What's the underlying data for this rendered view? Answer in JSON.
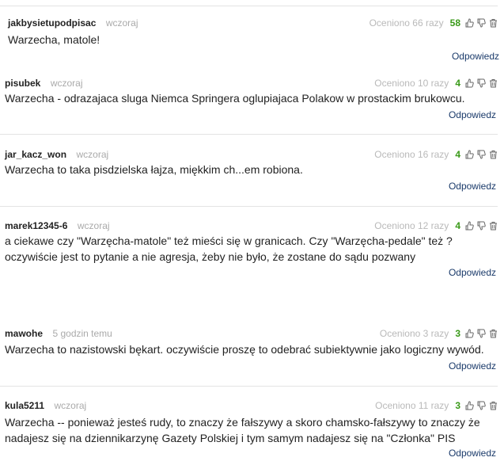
{
  "comments": [
    {
      "author": "jakbysietupodpisac",
      "time": "wczoraj",
      "rated_label": "Oceniono 66 razy",
      "score": "58",
      "text": "Warzecha, matole!",
      "reply_label": "Odpowiedz"
    },
    {
      "author": "pisubek",
      "time": "wczoraj",
      "rated_label": "Oceniono 10 razy",
      "score": "4",
      "text": "Warzecha - odrazajaca sluga Niemca Springera oglupiajaca Polakow w prostackim brukowcu.",
      "reply_label": "Odpowiedz"
    },
    {
      "author": "jar_kacz_won",
      "time": "wczoraj",
      "rated_label": "Oceniono 16 razy",
      "score": "4",
      "text": "Warzecha to taka pisdzielska łajza, miękkim ch...em robiona.",
      "reply_label": "Odpowiedz"
    },
    {
      "author": "marek12345-6",
      "time": "wczoraj",
      "rated_label": "Oceniono 12 razy",
      "score": "4",
      "text": "a ciekawe czy \"Warzęcha-matole\" też mieści się w granicach. Czy \"Warzęcha-pedale\" też ?\noczywiście jest to pytanie a nie agresja, żeby nie było, że zostane do sądu pozwany",
      "reply_label": "Odpowiedz"
    },
    {
      "author": "mawohe",
      "time": "5 godzin temu",
      "rated_label": "Oceniono 3 razy",
      "score": "3",
      "text": "Warzecha to nazistowski bękart. oczywiście proszę to odebrać subiektywnie jako logiczny wywód.",
      "reply_label": "Odpowiedz"
    },
    {
      "author": "kula5211",
      "time": "wczoraj",
      "rated_label": "Oceniono 11 razy",
      "score": "3",
      "text": "Warzecha -- ponieważ jesteś rudy, to znaczy że fałszywy a skoro chamsko-fałszywy to znaczy że\nnadajesz się na dziennikarzynę Gazety Polskiej i tym samym nadajesz się na \"Członka\" PIS",
      "reply_label": "Odpowiedz"
    }
  ],
  "icons": {
    "like": "thumbs-up-icon",
    "dislike": "thumbs-down-icon",
    "delete": "trash-icon"
  },
  "colors": {
    "score": "#3a9a19",
    "reply_link": "#1a3a6a",
    "muted": "#aaaaaa"
  }
}
